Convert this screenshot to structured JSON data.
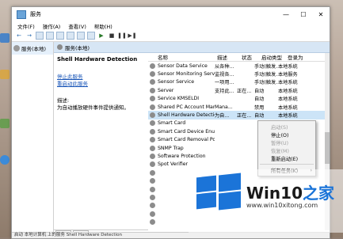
{
  "window": {
    "title": "服务",
    "controls": [
      "—",
      "☐",
      "✕"
    ]
  },
  "menu": [
    "文件(F)",
    "操作(A)",
    "查看(V)",
    "帮助(H)"
  ],
  "leftpane": {
    "node_label": "服务(本地)"
  },
  "main": {
    "header": "服务(本地)",
    "service_title": "Shell Hardware Detection",
    "stop_link": "停止此服务",
    "restart_link": "重启动此服务",
    "desc_label": "描述:",
    "desc_text": "为自动播放硬件事件提供通知。"
  },
  "grid": {
    "columns": [
      "名称",
      "描述",
      "状态",
      "启动类型",
      "登录为"
    ],
    "rows": [
      [
        "Sensor Data Service",
        "从各种...",
        "",
        "手动(触发...",
        "本地系统"
      ],
      [
        "Sensor Monitoring Service",
        "监视各...",
        "",
        "手动(触发...",
        "本地服务"
      ],
      [
        "Sensor Service",
        "一项用...",
        "",
        "手动(触发...",
        "本地系统"
      ],
      [
        "Server",
        "支持此...",
        "正在...",
        "自动",
        "本地系统"
      ],
      [
        "Service KMSELDI",
        "",
        "",
        "自动",
        "本地系统"
      ],
      [
        "Shared PC Account Mana...",
        "Mana...",
        "",
        "禁用",
        "本地系统"
      ],
      [
        "Shell Hardware Detection",
        "为自...",
        "正在...",
        "自动",
        "本地系统"
      ],
      [
        "Smart Card",
        "",
        "",
        "",
        ""
      ],
      [
        "Smart Card Device Enum...",
        "",
        "",
        "",
        ""
      ],
      [
        "Smart Card Removal Pol...",
        "",
        "",
        "",
        ""
      ],
      [
        "SNMP Trap",
        "",
        "",
        "",
        ""
      ],
      [
        "Software Protection",
        "",
        "",
        "",
        ""
      ],
      [
        "Spot Verifier",
        "",
        "",
        "",
        ""
      ],
      [
        "",
        "",
        "",
        "",
        ""
      ],
      [
        "",
        "",
        "",
        "",
        ""
      ],
      [
        "",
        "",
        "",
        "",
        ""
      ],
      [
        "",
        "",
        "",
        "",
        ""
      ],
      [
        "",
        "",
        "",
        "",
        ""
      ],
      [
        "",
        "",
        "",
        "",
        ""
      ],
      [
        "",
        "",
        "",
        "",
        ""
      ]
    ],
    "selected_index": 6
  },
  "context_menu": {
    "items": [
      {
        "label": "启动(S)",
        "disabled": true
      },
      {
        "label": "停止(O)",
        "disabled": false
      },
      {
        "label": "暂停(U)",
        "disabled": true
      },
      {
        "label": "恢复(M)",
        "disabled": true
      },
      {
        "label": "重新启动(E)",
        "disabled": false
      },
      {
        "label": "所有任务(K)",
        "disabled": false,
        "submenu": true
      }
    ]
  },
  "tabs": [
    "扩展",
    "标准"
  ],
  "statusbar": "启动 本地计算机 上的服务 Shell Hardware Detection",
  "watermark": {
    "name_prefix": "Win10",
    "name_accent": "之家",
    "url": "www.win10xitong.com"
  },
  "colors": {
    "accent": "#1b74d8",
    "selection": "#cce4f7",
    "link": "#1a56b8"
  }
}
